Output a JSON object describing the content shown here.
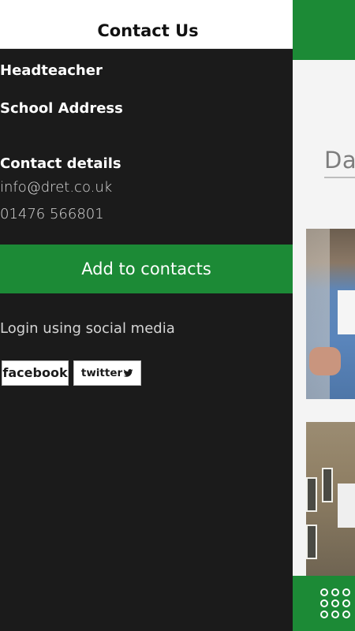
{
  "drawer": {
    "title": "Contact Us",
    "headteacher_label": "Headteacher",
    "school_address_label": "School Address",
    "contact_details_label": "Contact details",
    "email": "info@dret.co.uk",
    "phone": "01476 566801",
    "add_contacts_button": "Add to contacts",
    "social_label": "Login using social media",
    "facebook_button": "facebook",
    "twitter_button": "twitter"
  },
  "background_app": {
    "logo_text": "Dav",
    "footer_icon": "grid-menu-icon"
  },
  "colors": {
    "accent_green": "#1c8a36",
    "drawer_bg": "#1b1b1b",
    "header_bg": "#ffffff"
  }
}
